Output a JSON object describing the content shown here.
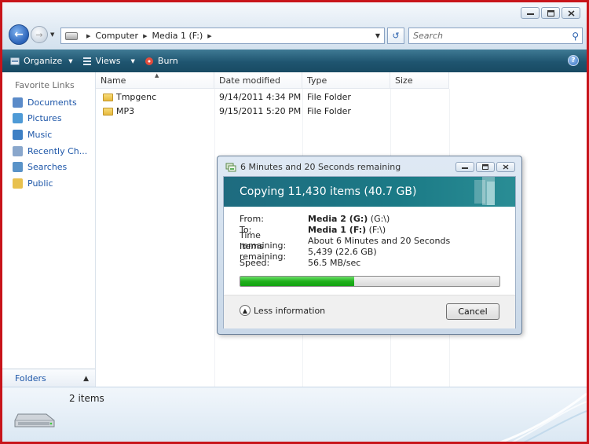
{
  "window": {
    "caption_buttons": [
      "minimize",
      "maximize",
      "close"
    ]
  },
  "address": {
    "segments": [
      "Computer",
      "Media 1 (F:)"
    ],
    "drive_icon": "drive-icon"
  },
  "search": {
    "placeholder": "Search"
  },
  "toolbar": {
    "organize": "Organize",
    "views": "Views",
    "burn": "Burn",
    "help": "?"
  },
  "sidebar": {
    "heading": "Favorite Links",
    "items": [
      {
        "label": "Documents",
        "icon": "documents-icon",
        "color": "#5b8bc9"
      },
      {
        "label": "Pictures",
        "icon": "pictures-icon",
        "color": "#4e9ad6"
      },
      {
        "label": "Music",
        "icon": "music-icon",
        "color": "#3d7fc4"
      },
      {
        "label": "Recently Ch...",
        "icon": "recent-icon",
        "color": "#8aa7cc"
      },
      {
        "label": "Searches",
        "icon": "searches-icon",
        "color": "#5a93c8"
      },
      {
        "label": "Public",
        "icon": "public-folder-icon",
        "color": "#e8c14f"
      }
    ],
    "folders_label": "Folders"
  },
  "filelist": {
    "columns": [
      "Name",
      "Date modified",
      "Type",
      "Size"
    ],
    "rows": [
      {
        "name": "Tmpgenc",
        "date": "9/14/2011 4:34 PM",
        "type": "File Folder",
        "size": ""
      },
      {
        "name": "MP3",
        "date": "9/15/2011 5:20 PM",
        "type": "File Folder",
        "size": ""
      }
    ]
  },
  "details": {
    "count": "2 items"
  },
  "dialog": {
    "title": "6 Minutes and 20 Seconds remaining",
    "heading": "Copying 11,430 items (40.7 GB)",
    "info": [
      {
        "key": "From:",
        "bold": "Media 2 (G:)",
        "rest": " (G:\\)"
      },
      {
        "key": "To:",
        "bold": "Media 1 (F:)",
        "rest": " (F:\\)"
      },
      {
        "key": "Time remaining:",
        "bold": "",
        "rest": "About 6 Minutes and 20 Seconds"
      },
      {
        "key": "Items remaining:",
        "bold": "",
        "rest": "5,439 (22.6 GB)"
      },
      {
        "key": "Speed:",
        "bold": "",
        "rest": "56.5 MB/sec"
      }
    ],
    "progress": 0.44,
    "less_label": "Less information",
    "cancel_label": "Cancel"
  },
  "colors": {
    "frame_border": "#c8141a",
    "toolbar_bg": "#1f5570",
    "link_blue": "#1d56a8",
    "banner_teal": "#1b7a86",
    "progress_green": "#20b01c"
  }
}
